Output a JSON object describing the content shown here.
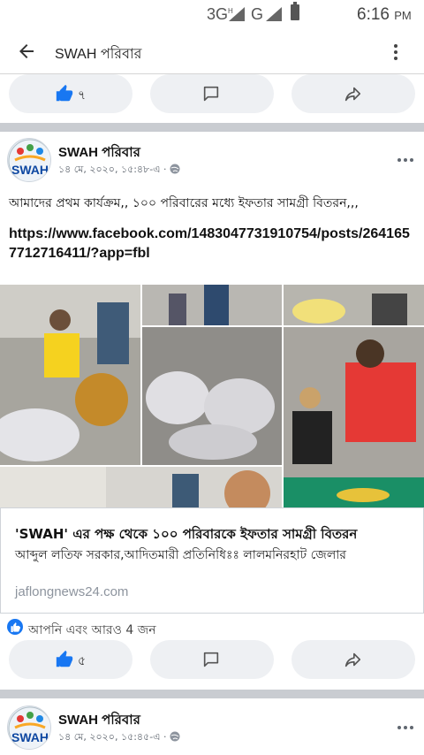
{
  "status_bar": {
    "network_3g": "3G",
    "network_h": "H",
    "network_g": "G",
    "time": "6:16",
    "ampm": "PM"
  },
  "header": {
    "title": "SWAH পরিবার"
  },
  "top_actions": {
    "like_count": "৭"
  },
  "post1": {
    "author": "SWAH পরিবার",
    "avatar_text": "SWAH",
    "date": "১৪ মে, ২০২০, ১৫:৪৮-এ ·",
    "text": "আমাদের প্রথম কার্যক্রম,, ১০০ পরিবারের মধ্যে ইফতার সামগ্রী বিতরন,,,",
    "link": "https://www.facebook.com/1483047731910754/posts/2641657712716411/?app=fbl",
    "link_card": {
      "title": "'SWAH' এর পক্ষ থেকে ১০০ পরিবারকে ইফতার সামগ্রী বিতরন",
      "subtitle": "আব্দুল লতিফ সরকার,আদিতমারী প্রতিনিধিঃঃ লালমনিরহাট জেলার",
      "domain": "jaflongnews24.com"
    },
    "reactions_text": "আপনি এবং আরও 4 জন",
    "like_count": "৫"
  },
  "post2": {
    "author": "SWAH পরিবার",
    "avatar_text": "SWAH",
    "date": "১৪ মে, ২০২০, ১৫:৪৫-এ ·"
  },
  "colors": {
    "accent": "#1877f2",
    "separator": "#c9ccd1",
    "pill": "#eef0f3"
  }
}
